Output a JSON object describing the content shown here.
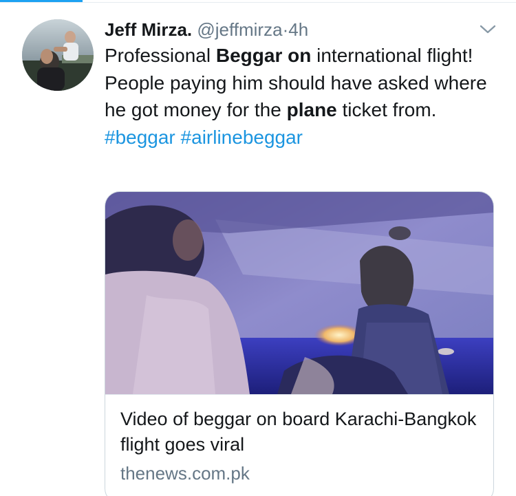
{
  "tweet": {
    "author_name": "Jeff Mirza.",
    "author_handle": "@jeffmirza",
    "separator": "·",
    "timestamp": "4h",
    "text_segments": [
      {
        "text": "Professional ",
        "style": "normal"
      },
      {
        "text": "Beggar on",
        "style": "bold"
      },
      {
        "text": " international flight! People paying him should have asked where he got money for the ",
        "style": "normal"
      },
      {
        "text": "plane",
        "style": "bold"
      },
      {
        "text": " ticket from. ",
        "style": "normal"
      },
      {
        "text": "#beggar",
        "style": "hashtag"
      },
      {
        "text": " ",
        "style": "normal"
      },
      {
        "text": "#airlinebeggar",
        "style": "hashtag"
      }
    ],
    "menu_icon": "chevron-down-icon"
  },
  "card": {
    "title": "Video of beggar on board Karachi-Bangkok flight goes viral",
    "domain": "thenews.com.pk"
  },
  "colors": {
    "text": "#14171a",
    "secondary": "#657786",
    "link": "#1b95e0",
    "accent": "#1da1f2",
    "border": "#ccd6dd"
  }
}
